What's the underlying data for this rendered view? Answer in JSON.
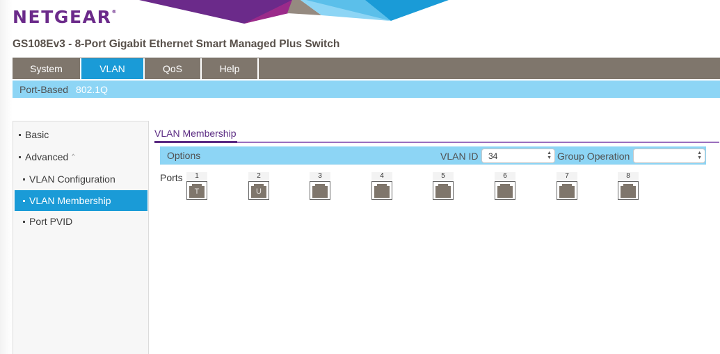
{
  "brand": {
    "logo_text": "NETGEAR",
    "registered_mark": "®",
    "colors": {
      "purple": "#6b2a8a",
      "magenta": "#9b2a8a",
      "taupe": "#958a80",
      "light_blue": "#8dd5f5",
      "sky_blue": "#5bbfea",
      "blue": "#1a9bd7"
    }
  },
  "product_title": "GS108Ev3 - 8-Port Gigabit Ethernet Smart Managed Plus Switch",
  "main_nav": {
    "tabs": [
      {
        "label": "System",
        "active": false
      },
      {
        "label": "VLAN",
        "active": true
      },
      {
        "label": "QoS",
        "active": false
      },
      {
        "label": "Help",
        "active": false
      }
    ]
  },
  "sub_nav": {
    "items": [
      {
        "label": "Port-Based",
        "active": false
      },
      {
        "label": "802.1Q",
        "active": true
      }
    ]
  },
  "sidebar": {
    "items": [
      {
        "label": "Basic",
        "level": 1,
        "active": false
      },
      {
        "label": "Advanced",
        "level": 1,
        "active": false,
        "expanded": true,
        "icon": "chevron-up-icon",
        "icon_glyph": "^"
      },
      {
        "label": "VLAN Configuration",
        "level": 2,
        "active": false
      },
      {
        "label": "VLAN Membership",
        "level": 2,
        "active": true
      },
      {
        "label": "Port PVID",
        "level": 2,
        "active": false
      }
    ]
  },
  "content": {
    "tab_title": "VLAN Membership",
    "options": {
      "label": "Options",
      "vlan_id_label": "VLAN ID",
      "vlan_id_value": "34",
      "group_operation_label": "Group Operation",
      "group_operation_value": ""
    },
    "ports_label": "Ports",
    "ports": [
      {
        "number": "1",
        "mode": "T"
      },
      {
        "number": "2",
        "mode": "U"
      },
      {
        "number": "3",
        "mode": ""
      },
      {
        "number": "4",
        "mode": ""
      },
      {
        "number": "5",
        "mode": ""
      },
      {
        "number": "6",
        "mode": ""
      },
      {
        "number": "7",
        "mode": ""
      },
      {
        "number": "8",
        "mode": ""
      }
    ]
  }
}
